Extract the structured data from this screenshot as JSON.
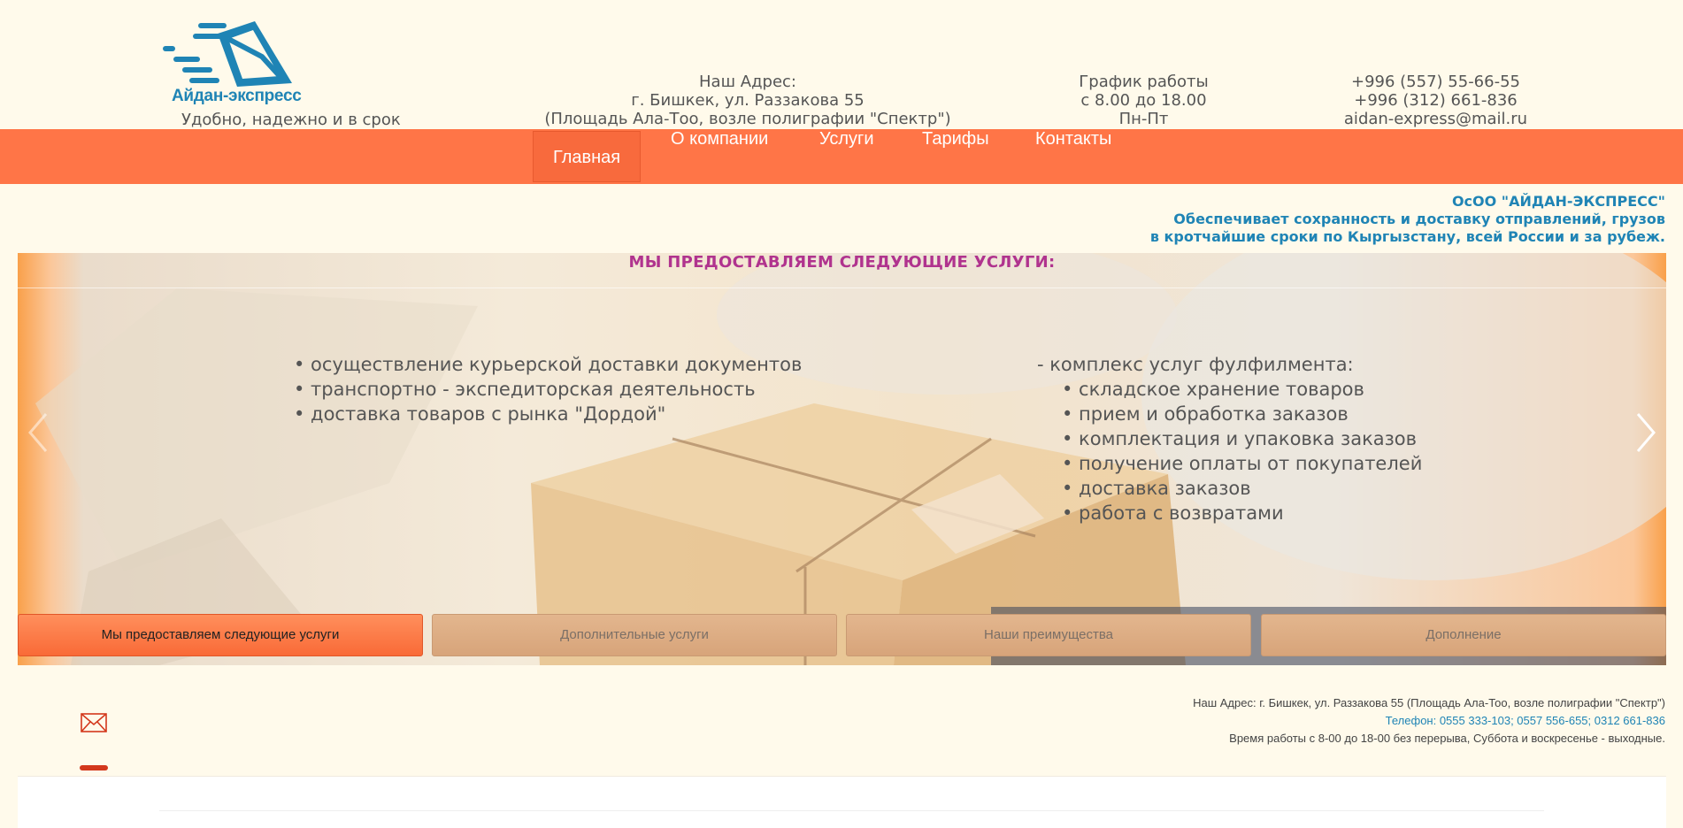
{
  "header": {
    "logo_text": "Айдан-экспресс",
    "slogan": "Удобно, надежно и в срок",
    "address": {
      "label": "Наш Адрес:",
      "line1": "г. Бишкек, ул. Раззакова 55",
      "line2": "(Площадь Ала-Тоо, возле полиграфии \"Спектр\")"
    },
    "hours": {
      "label": "График работы",
      "time": "с 8.00 до 18.00",
      "days": "Пн-Пт"
    },
    "contacts": {
      "phone1": "+996 (557) 55-66-55",
      "phone2": "+996 (312) 661-836",
      "email": "aidan-express@mail.ru"
    }
  },
  "nav": {
    "items": [
      {
        "label": "Главная",
        "active": true
      },
      {
        "label": "О компании"
      },
      {
        "label": "Услуги"
      },
      {
        "label": "Тарифы"
      },
      {
        "label": "Контакты"
      }
    ]
  },
  "company": {
    "name": "ОсОО \"АЙДАН-ЭКСПРЕСС\"",
    "line1": "Обеспечивает сохранность и доставку отправлений, грузов",
    "line2": "в кротчайшие сроки по Кыргызстану, всей России и за рубеж."
  },
  "slider": {
    "title": "МЫ ПРЕДОСТАВЛЯЕМ СЛЕДУЮЩИЕ УСЛУГИ:",
    "left_list": [
      "• осуществление курьерской доставки документов",
      "• транспортно - экспедиторская деятельность",
      "• доставка товаров с рынка \"Дордой\""
    ],
    "right_heading": "- комплекс услуг фулфилмента:",
    "right_list": [
      "• складское хранение товаров",
      "• прием и обработка заказов",
      "• комплектация и упаковка заказов",
      "• получение оплаты от покупателей",
      "• доставка заказов",
      "• работа с возвратами"
    ],
    "tabs": [
      {
        "label": "Мы предоставляем следующие услуги",
        "active": true
      },
      {
        "label": "Дополнительные услуги"
      },
      {
        "label": "Наши преимущества"
      },
      {
        "label": "Дополнение"
      }
    ]
  },
  "footer": {
    "address": "Наш Адрес: г. Бишкек, ул. Раззакова 55 (Площадь Ала-Тоо, возле полиграфии \"Спектр\")",
    "phones": "Телефон: 0555 333-103; 0557 556-655; 0312 661-836",
    "hours": "Время работы с 8-00 до 18-00 без перерыва, Суббота и воскресенье - выходные."
  },
  "colors": {
    "nav_bg": "#ff7547",
    "brand_blue": "#1f84b5",
    "title_purple": "#b0338e",
    "page_bg": "#fffaeb"
  }
}
